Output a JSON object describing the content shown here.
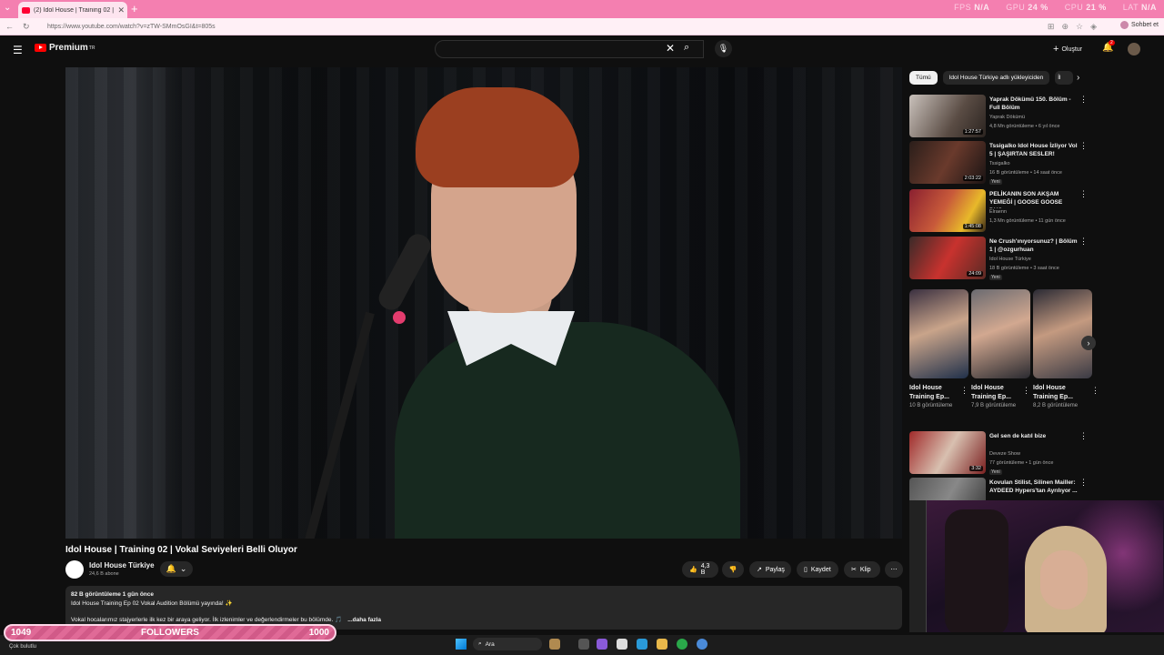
{
  "browser": {
    "tab_title": "(2) Idol House | Training 02 | Vokal",
    "url": "https://www.youtube.com/watch?v=zTW-SMmOsGI&t=805s",
    "chat_label": "Sohbet et",
    "stats": [
      {
        "label": "FPS",
        "value": "N/A"
      },
      {
        "label": "GPU",
        "value": "24 %"
      },
      {
        "label": "CPU",
        "value": "21 %"
      },
      {
        "label": "LAT",
        "value": "N/A"
      }
    ]
  },
  "header": {
    "brand": "Premium",
    "create_label": "Oluştur",
    "notification_count": "2"
  },
  "video": {
    "title": "Idol House | Training 02 | Vokal Seviyeleri Belli Oluyor",
    "channel": "Idol House Türkiye",
    "subscribers": "24,6 B abone",
    "likes": "4,3 B",
    "share_label": "Paylaş",
    "save_label": "Kaydet",
    "clip_label": "Klip",
    "views_line": "82 B görüntüleme  1 gün önce",
    "desc_line1": "Idol House Training Ep 02 Vokal Audition Bölümü yayında! ✨",
    "desc_line2": "Vokal hocalarımız stajyerlerle ilk kez bir araya geliyor. İlk izlenimler ve değerlendirmeler bu bölümde. 🎵",
    "more_label": "...daha fazla"
  },
  "sidebar": {
    "chips": [
      "Tümü",
      "Idol House Türkiye adlı yükleyiciden",
      "İl"
    ],
    "recs": [
      {
        "title": "Yaprak Dökümü 150. Bölüm - Full Bölüm",
        "channel": "Yaprak Dökümü",
        "stats": "4,8 Mn görüntüleme • 6 yıl önce",
        "duration": "1:27:57",
        "badge": ""
      },
      {
        "title": "Tssigalko Idol House İzliyor Vol 5 | ŞAŞIRTAN SESLER!",
        "channel": "Tssigalko",
        "stats": "16 B görüntüleme • 14 saat önce",
        "duration": "2:03:22",
        "badge": "Yeni"
      },
      {
        "title": "PELİKANIN SON AKŞAM YEMEĞİ | GOOSE GOOSE DUC...",
        "channel": "Elraenn",
        "stats": "1,3 Mn görüntüleme • 11 gün önce",
        "duration": "1:45:08",
        "badge": ""
      },
      {
        "title": "Ne Crush'ınıyorsunuz? | Bölüm 1 | @ozgurhuan",
        "channel": "Idol House Türkiye",
        "stats": "18 B görüntüleme • 3 saat önce",
        "duration": "24:09",
        "badge": "Yeni"
      },
      {
        "title": "Gel sen de katıl bize",
        "channel": "Deveze Show",
        "stats": "77 görüntüleme • 1 gün önce",
        "duration": "3:32",
        "badge": "Yeni"
      },
      {
        "title": "Kovulan Stilist, Silinen Mailler: AYDEED Hypers'tan Ayrılıyor ...",
        "channel": "",
        "stats": "",
        "duration": "",
        "badge": ""
      }
    ],
    "shorts": [
      {
        "title": "Idol House Training Ep...",
        "views": "10 B görüntüleme"
      },
      {
        "title": "Idol House Training Ep...",
        "views": "7,9 B görüntüleme"
      },
      {
        "title": "Idol House Training Ep...",
        "views": "8,2 B görüntüleme"
      }
    ]
  },
  "overlay": {
    "followers_current": "1049",
    "followers_label": "FOLLOWERS",
    "followers_goal": "1000"
  },
  "taskbar": {
    "search_placeholder": "Ara",
    "weather": "Çok bulutlu"
  },
  "colors": {
    "accent": "#ff0000",
    "tabbar": "#f47fb0"
  }
}
